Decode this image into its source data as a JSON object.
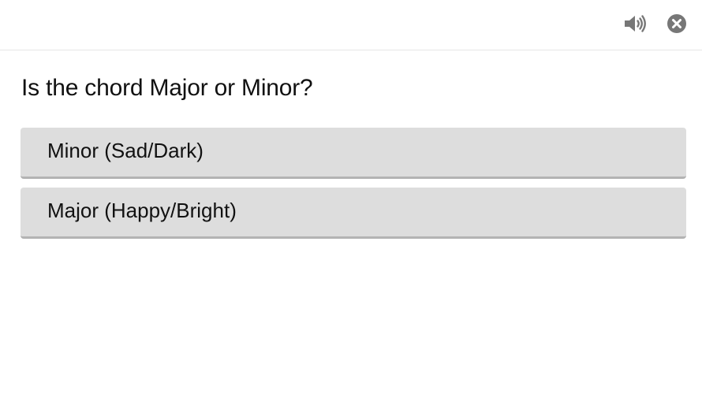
{
  "header": {
    "speaker_icon": "speaker-volume-icon",
    "close_icon": "close-circle-icon"
  },
  "question": {
    "text": "Is the chord Major or Minor?"
  },
  "options": [
    {
      "label": "Minor (Sad/Dark)"
    },
    {
      "label": "Major (Happy/Bright)"
    }
  ],
  "colors": {
    "option_bg": "#dddddd",
    "option_border": "#b3b3b3",
    "icon": "#777777",
    "divider": "#e6e6e6"
  }
}
